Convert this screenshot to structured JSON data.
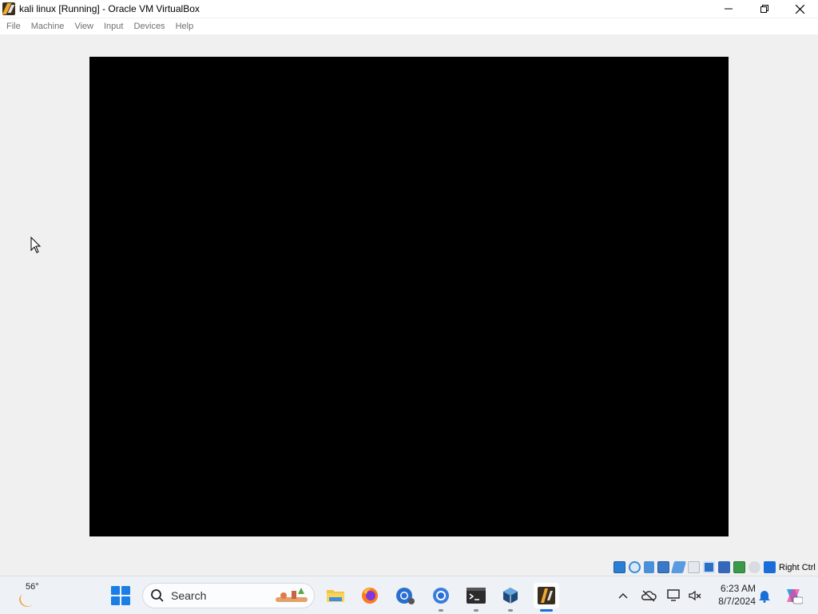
{
  "window": {
    "title": "kali linux [Running] - Oracle VM VirtualBox",
    "app_icon": "virtualbox-vm-icon"
  },
  "menu": {
    "items": [
      {
        "label": "File"
      },
      {
        "label": "Machine"
      },
      {
        "label": "View"
      },
      {
        "label": "Input"
      },
      {
        "label": "Devices"
      },
      {
        "label": "Help"
      }
    ]
  },
  "vm_display": {
    "state": "black screen"
  },
  "status_bar": {
    "icons": [
      "hard-disk-icon",
      "optical-drive-icon",
      "audio-icon",
      "network-icon",
      "usb-icon",
      "shared-folders-icon",
      "display-icon",
      "video-capture-icon",
      "cpu-icon",
      "mouse-integration-icon",
      "keyboard-capture-icon"
    ],
    "host_key_label": "Right Ctrl"
  },
  "taskbar": {
    "weather_temp": "56°",
    "search_placeholder": "Search",
    "apps": [
      "file-explorer-icon",
      "firefox-icon",
      "chrome-profile-icon",
      "chrome-icon",
      "terminal-icon",
      "virtualbox-icon",
      "virtualbox-vm-icon"
    ],
    "clock_time": "6:23 AM",
    "clock_date": "8/7/2024"
  },
  "colors": {
    "accent": "#1a6ed8",
    "vm_background": "#000000",
    "window_background": "#f0f0f0"
  }
}
